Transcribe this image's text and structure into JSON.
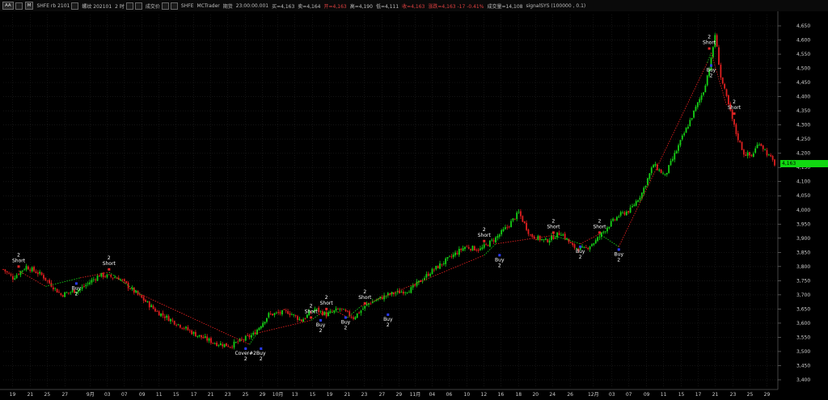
{
  "toolbar": {
    "btn1": "AA",
    "btn2": "M",
    "symbol": "SHFE rb 2101",
    "items": [
      "螺纹 202101",
      "2 时",
      "成交价",
      "SHFE",
      "MCTrader",
      "期货",
      "23:00:00.001"
    ],
    "bid": "买=4,163",
    "ask": "卖=4,164",
    "open": "开=4,163",
    "high": "高=4,190",
    "low": "低=4,111",
    "close": "收=4,163",
    "change": "涨跌=4,163 -17 -0.41%",
    "volume": "成交量=14,108",
    "strategy": "signalSYS (100000 , 0.1)",
    "icons": [
      "window-icon",
      "chart-icon",
      "settings-icon",
      "indicator-icon",
      "pin-icon",
      "link-icon"
    ]
  },
  "current_price_label": "4,163",
  "colors": {
    "up": "#16d016",
    "down": "#e02020",
    "buy": "#2a3cff",
    "short": "#e02828",
    "grid": "#1c1c1c",
    "axis_text": "#cfcfcf"
  },
  "chart_data": {
    "type": "candlestick",
    "y_axis": {
      "min": 3400,
      "max": 4650,
      "ticks": [
        3400,
        3450,
        3500,
        3550,
        3600,
        3650,
        3700,
        3750,
        3800,
        3850,
        3900,
        3950,
        4000,
        4050,
        4100,
        4150,
        4200,
        4250,
        4300,
        4350,
        4400,
        4450,
        4500,
        4550,
        4600,
        4650
      ],
      "tick_labels": [
        "3,400",
        "3,450",
        "3,500",
        "3,550",
        "3,600",
        "3,650",
        "3,700",
        "3,750",
        "3,800",
        "3,850",
        "3,900",
        "3,950",
        "4,000",
        "4,050",
        "4,100",
        "4,150",
        "4,200",
        "4,250",
        "4,300",
        "4,350",
        "4,400",
        "4,450",
        "4,500",
        "4,550",
        "4,600",
        "4,650"
      ]
    },
    "x_axis_labels": [
      {
        "label": "19",
        "t": 0.012
      },
      {
        "label": "21",
        "t": 0.035
      },
      {
        "label": "25",
        "t": 0.057
      },
      {
        "label": "27",
        "t": 0.08
      },
      {
        "label": "9月",
        "t": 0.113
      },
      {
        "label": "03",
        "t": 0.135
      },
      {
        "label": "07",
        "t": 0.157
      },
      {
        "label": "09",
        "t": 0.18
      },
      {
        "label": "11",
        "t": 0.202
      },
      {
        "label": "15",
        "t": 0.224
      },
      {
        "label": "17",
        "t": 0.247
      },
      {
        "label": "21",
        "t": 0.269
      },
      {
        "label": "23",
        "t": 0.291
      },
      {
        "label": "25",
        "t": 0.314
      },
      {
        "label": "29",
        "t": 0.336
      },
      {
        "label": "10月",
        "t": 0.356
      },
      {
        "label": "13",
        "t": 0.378
      },
      {
        "label": "15",
        "t": 0.401
      },
      {
        "label": "19",
        "t": 0.423
      },
      {
        "label": "21",
        "t": 0.446
      },
      {
        "label": "23",
        "t": 0.468
      },
      {
        "label": "27",
        "t": 0.491
      },
      {
        "label": "29",
        "t": 0.513
      },
      {
        "label": "11月",
        "t": 0.534
      },
      {
        "label": "04",
        "t": 0.556
      },
      {
        "label": "06",
        "t": 0.578
      },
      {
        "label": "10",
        "t": 0.601
      },
      {
        "label": "12",
        "t": 0.623
      },
      {
        "label": "16",
        "t": 0.645
      },
      {
        "label": "18",
        "t": 0.668
      },
      {
        "label": "20",
        "t": 0.69
      },
      {
        "label": "24",
        "t": 0.712
      },
      {
        "label": "26",
        "t": 0.735
      },
      {
        "label": "12月",
        "t": 0.765
      },
      {
        "label": "03",
        "t": 0.789
      },
      {
        "label": "07",
        "t": 0.811
      },
      {
        "label": "09",
        "t": 0.834
      },
      {
        "label": "11",
        "t": 0.856
      },
      {
        "label": "15",
        "t": 0.879
      },
      {
        "label": "17",
        "t": 0.901
      },
      {
        "label": "21",
        "t": 0.923
      },
      {
        "label": "23",
        "t": 0.946
      },
      {
        "label": "25",
        "t": 0.968
      },
      {
        "label": "29",
        "t": 0.99
      }
    ],
    "anchors": [
      [
        0,
        3790
      ],
      [
        5,
        3760
      ],
      [
        12,
        3800
      ],
      [
        20,
        3770
      ],
      [
        30,
        3700
      ],
      [
        40,
        3720
      ],
      [
        50,
        3770
      ],
      [
        60,
        3760
      ],
      [
        70,
        3700
      ],
      [
        80,
        3640
      ],
      [
        90,
        3600
      ],
      [
        100,
        3560
      ],
      [
        110,
        3530
      ],
      [
        118,
        3520
      ],
      [
        124,
        3540
      ],
      [
        130,
        3560
      ],
      [
        138,
        3630
      ],
      [
        148,
        3640
      ],
      [
        155,
        3610
      ],
      [
        162,
        3650
      ],
      [
        168,
        3630
      ],
      [
        175,
        3650
      ],
      [
        182,
        3620
      ],
      [
        190,
        3670
      ],
      [
        200,
        3700
      ],
      [
        212,
        3720
      ],
      [
        222,
        3780
      ],
      [
        232,
        3830
      ],
      [
        240,
        3870
      ],
      [
        248,
        3860
      ],
      [
        256,
        3900
      ],
      [
        262,
        3940
      ],
      [
        268,
        3990
      ],
      [
        274,
        3910
      ],
      [
        282,
        3890
      ],
      [
        290,
        3920
      ],
      [
        296,
        3870
      ],
      [
        302,
        3860
      ],
      [
        308,
        3890
      ],
      [
        314,
        3940
      ],
      [
        320,
        3980
      ],
      [
        326,
        4000
      ],
      [
        332,
        4060
      ],
      [
        338,
        4160
      ],
      [
        344,
        4120
      ],
      [
        350,
        4210
      ],
      [
        356,
        4300
      ],
      [
        360,
        4360
      ],
      [
        364,
        4420
      ],
      [
        368,
        4530
      ],
      [
        370,
        4620
      ],
      [
        373,
        4470
      ],
      [
        377,
        4370
      ],
      [
        381,
        4270
      ],
      [
        385,
        4200
      ],
      [
        389,
        4190
      ],
      [
        393,
        4240
      ],
      [
        397,
        4200
      ],
      [
        401,
        4163
      ]
    ],
    "candle_count": 402,
    "trade_line_points": [
      {
        "i": 8,
        "p": 3785
      },
      {
        "i": 22,
        "p": 3730
      },
      {
        "i": 40,
        "p": 3760
      },
      {
        "i": 55,
        "p": 3780
      },
      {
        "i": 72,
        "p": 3700
      },
      {
        "i": 128,
        "p": 3525
      },
      {
        "i": 132,
        "p": 3565
      },
      {
        "i": 160,
        "p": 3610
      },
      {
        "i": 164,
        "p": 3630
      },
      {
        "i": 167,
        "p": 3635
      },
      {
        "i": 174,
        "p": 3640
      },
      {
        "i": 179,
        "p": 3620
      },
      {
        "i": 186,
        "p": 3660
      },
      {
        "i": 250,
        "p": 3840
      },
      {
        "i": 256,
        "p": 3880
      },
      {
        "i": 286,
        "p": 3910
      },
      {
        "i": 300,
        "p": 3880
      },
      {
        "i": 310,
        "p": 3915
      },
      {
        "i": 320,
        "p": 3870
      },
      {
        "i": 366,
        "p": 4520
      },
      {
        "i": 368,
        "p": 4555
      },
      {
        "i": 376,
        "p": 4370
      }
    ],
    "signals": [
      {
        "type": "short",
        "label": "Short",
        "qty": "2",
        "i": 8,
        "p": 3790
      },
      {
        "type": "buy",
        "label": "Buy",
        "qty": "2",
        "i": 38,
        "p": 3750
      },
      {
        "type": "short",
        "label": "Short",
        "qty": "2",
        "i": 55,
        "p": 3780
      },
      {
        "type": "cover",
        "label": "Cover#2",
        "qty": "2",
        "i": 126,
        "p": 3520
      },
      {
        "type": "buy",
        "label": "Buy",
        "qty": "2",
        "i": 134,
        "p": 3520
      },
      {
        "type": "short",
        "label": "Short",
        "qty": "2",
        "i": 160,
        "p": 3610
      },
      {
        "type": "buy",
        "label": "Buy",
        "qty": "2",
        "i": 165,
        "p": 3620
      },
      {
        "type": "short",
        "label": "Short",
        "qty": "2",
        "i": 168,
        "p": 3640
      },
      {
        "type": "buy",
        "label": "Buy",
        "qty": "2",
        "i": 178,
        "p": 3630
      },
      {
        "type": "short",
        "label": "Short",
        "qty": "2",
        "i": 188,
        "p": 3660
      },
      {
        "type": "buy",
        "label": "Buy",
        "qty": "2",
        "i": 200,
        "p": 3640
      },
      {
        "type": "short",
        "label": "Short",
        "qty": "2",
        "i": 250,
        "p": 3880
      },
      {
        "type": "buy",
        "label": "Buy",
        "qty": "2",
        "i": 258,
        "p": 3850
      },
      {
        "type": "short",
        "label": "Short",
        "qty": "2",
        "i": 286,
        "p": 3910
      },
      {
        "type": "buy",
        "label": "Buy",
        "qty": "2",
        "i": 300,
        "p": 3880
      },
      {
        "type": "short",
        "label": "Short",
        "qty": "2",
        "i": 310,
        "p": 3910
      },
      {
        "type": "buy",
        "label": "Buy",
        "qty": "2",
        "i": 320,
        "p": 3870
      },
      {
        "type": "short",
        "label": "Short",
        "qty": "2",
        "i": 367,
        "p": 4560
      },
      {
        "type": "buy",
        "label": "Buy",
        "qty": "2",
        "i": 368,
        "p": 4520
      },
      {
        "type": "short",
        "label": "Short",
        "qty": "2",
        "i": 380,
        "p": 4330
      }
    ],
    "last_price": 4163
  }
}
